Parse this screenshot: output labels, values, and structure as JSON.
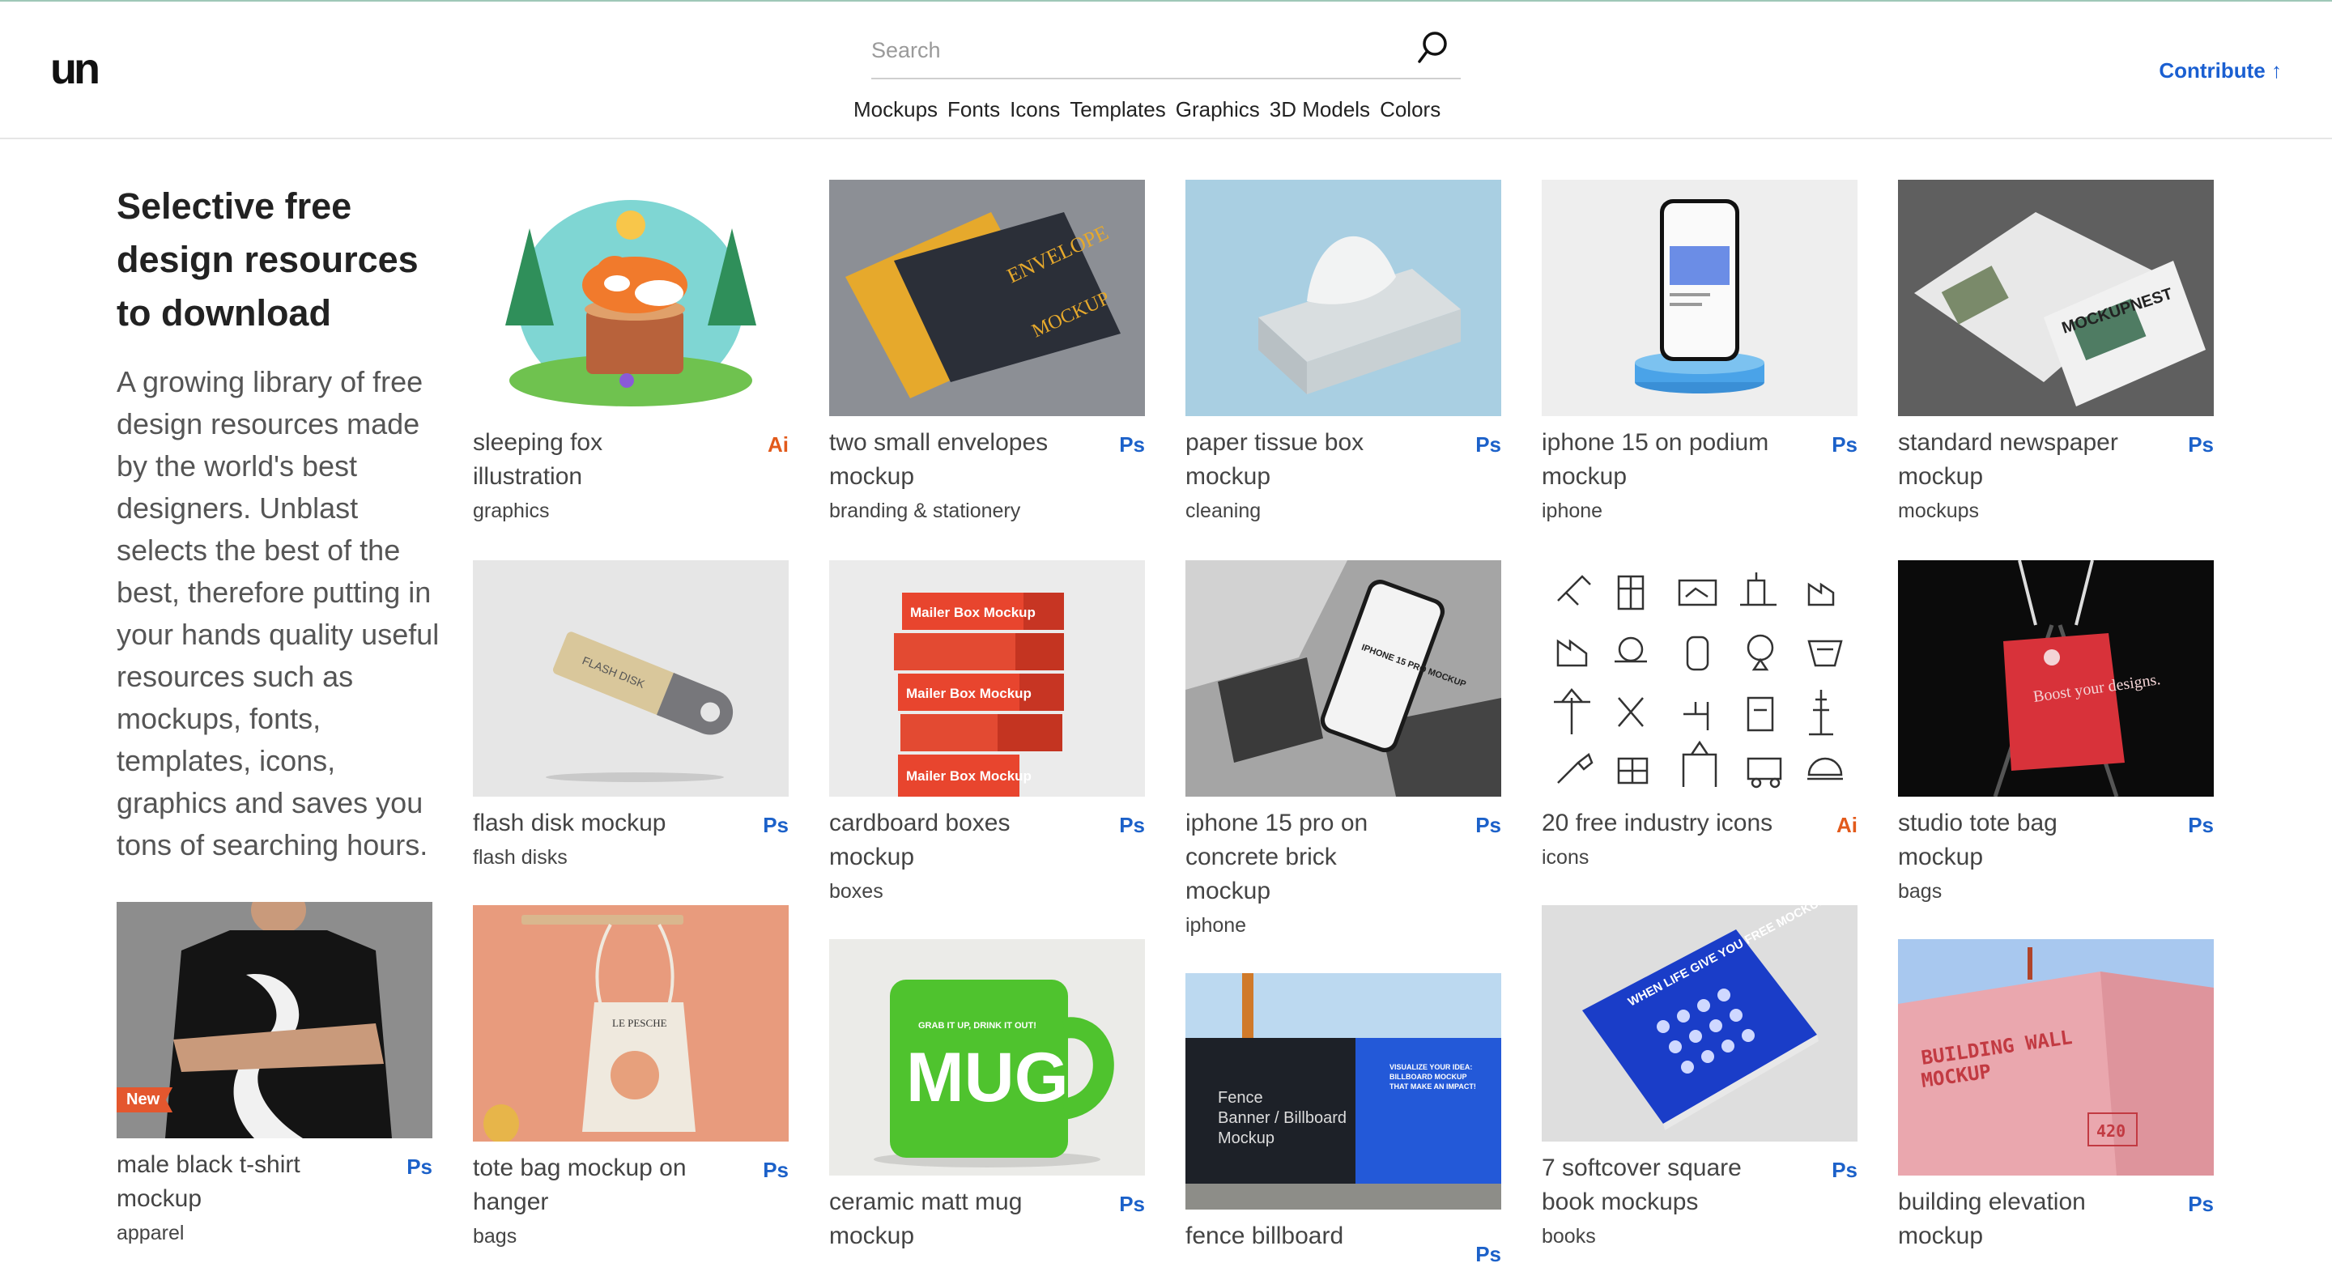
{
  "header": {
    "logo": "un",
    "search_placeholder": "Search",
    "nav": [
      "Mockups",
      "Fonts",
      "Icons",
      "Templates",
      "Graphics",
      "3D Models",
      "Colors"
    ],
    "contribute": "Contribute ↑"
  },
  "intro": {
    "title": "Selective free design resources to download",
    "description": "A growing library of free design resources made by the world's best designers. Unblast selects the best of the best, therefore putting in your hands quality useful resources such as mockups, fonts, templates, icons, graphics and saves you tons of searching hours."
  },
  "cards": [
    {
      "title": "sleeping fox illustration",
      "category": "graphics",
      "badge": "Ai"
    },
    {
      "title": "two small envelopes mockup",
      "category": "branding & stationery",
      "badge": "Ps"
    },
    {
      "title": "paper tissue box mockup",
      "category": "cleaning",
      "badge": "Ps"
    },
    {
      "title": "iphone 15 on podium mockup",
      "category": "iphone",
      "badge": "Ps"
    },
    {
      "title": "standard newspaper mockup",
      "category": "mockups",
      "badge": "Ps"
    },
    {
      "title": "flash disk mockup",
      "category": "flash disks",
      "badge": "Ps"
    },
    {
      "title": "cardboard boxes mockup",
      "category": "boxes",
      "badge": "Ps"
    },
    {
      "title": "iphone 15 pro on concrete brick mockup",
      "category": "iphone",
      "badge": "Ps"
    },
    {
      "title": "20 free industry icons",
      "category": "icons",
      "badge": "Ai"
    },
    {
      "title": "studio tote bag mockup",
      "category": "bags",
      "badge": "Ps"
    },
    {
      "title": "male black t-shirt mockup",
      "category": "apparel",
      "badge": "Ps",
      "tag": "New"
    },
    {
      "title": "tote bag mockup on hanger",
      "category": "bags",
      "badge": "Ps"
    },
    {
      "title": "ceramic matt mug mockup",
      "category": "",
      "badge": "Ps"
    },
    {
      "title": "fence billboard",
      "category": "",
      "badge": "Ps"
    },
    {
      "title": "7 softcover square book mockups",
      "category": "books",
      "badge": "Ps"
    },
    {
      "title": "building elevation mockup",
      "category": "",
      "badge": "Ps"
    }
  ],
  "thumb_text": {
    "envelope_1": "ENVELOPE",
    "envelope_2": "MOCKUP",
    "newspaper": "MOCKUPNEST",
    "flash": "FLASH DISK",
    "mailer": "Mailer Box Mockup",
    "phone": "IPHONE 15 PRO MOCKUP",
    "tote": "Boost your designs.",
    "mug_small": "GRAB IT UP, DRINK IT OUT!",
    "mug": "MUG",
    "fence_1": "Fence",
    "fence_2": "Banner / Billboard",
    "fence_3": "Mockup",
    "fence_right": "VISUALIZE YOUR IDEA: BILLBOARD MOCKUP THAT MAKE AN IMPACT!",
    "book": "WHEN LIFE GIVE YOU FREE MOCKUPS",
    "building_1": "BUILDING WALL",
    "building_2": "MOCKUP",
    "building_num": "420",
    "hanger_bag": "LE PESCHE"
  },
  "colors": {
    "accent": "#1c61c9",
    "ai_badge": "#e25a1b",
    "new_tag": "#e4572e"
  }
}
